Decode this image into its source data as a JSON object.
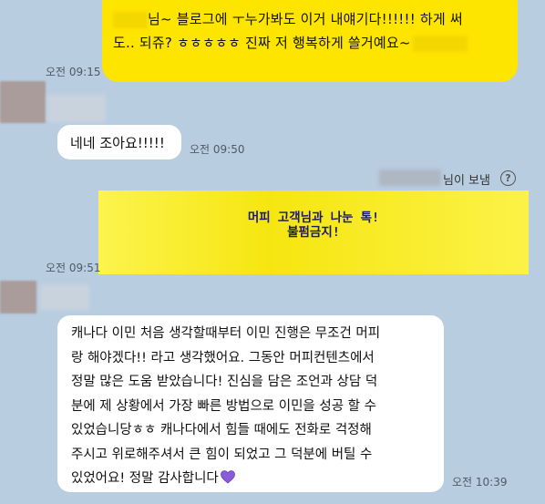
{
  "messages": {
    "outgoing_top": {
      "line1": "님~ 블로그에 ㅜ누가봐도 이거 내얘기다!!!!!! 하게 써",
      "line2": "도.. 되쥬? ㅎㅎㅎㅎㅎ 진짜 저 행복하게 쓸거예요~",
      "time": "오전 09:15"
    },
    "reply_1": {
      "text": "네네 조아요!!!!!",
      "time": "오전 09:50"
    },
    "shared_post": {
      "sender_suffix": "님이 보냄",
      "banner_line1": "머피 고객님과 나눈 톡!",
      "banner_line2": "불펌금지!",
      "time": "오전 09:51"
    },
    "reply_2": {
      "lines": [
        "캐나다 이민 처음 생각할때부터 이민 진행은 무조건 머피",
        "랑 해야겠다!! 라고 생각했어요. 그동안 머피컨텐츠에서",
        "정말 많은 도움 받았습니다! 진심을 담은 조언과 상담 덕",
        "분에 제 상황에서 가장 빠른 방법으로 이민을 성공 할 수",
        "있었습니당ㅎㅎ 캐나다에서 힘들 때에도 전화로 걱정해",
        "주시고 위로해주셔서 큰 힘이 되었고 그 덕분에 버틸 수",
        "있었어요! 정말 감사합니다"
      ],
      "emoji": "purple-heart",
      "time": "오전 10:39"
    }
  },
  "icons": {
    "help": "?"
  },
  "colors": {
    "background": "#b9cde0",
    "outgoing_bubble": "#fee500",
    "incoming_bubble": "#ffffff",
    "heart": "#8a5bd6"
  }
}
